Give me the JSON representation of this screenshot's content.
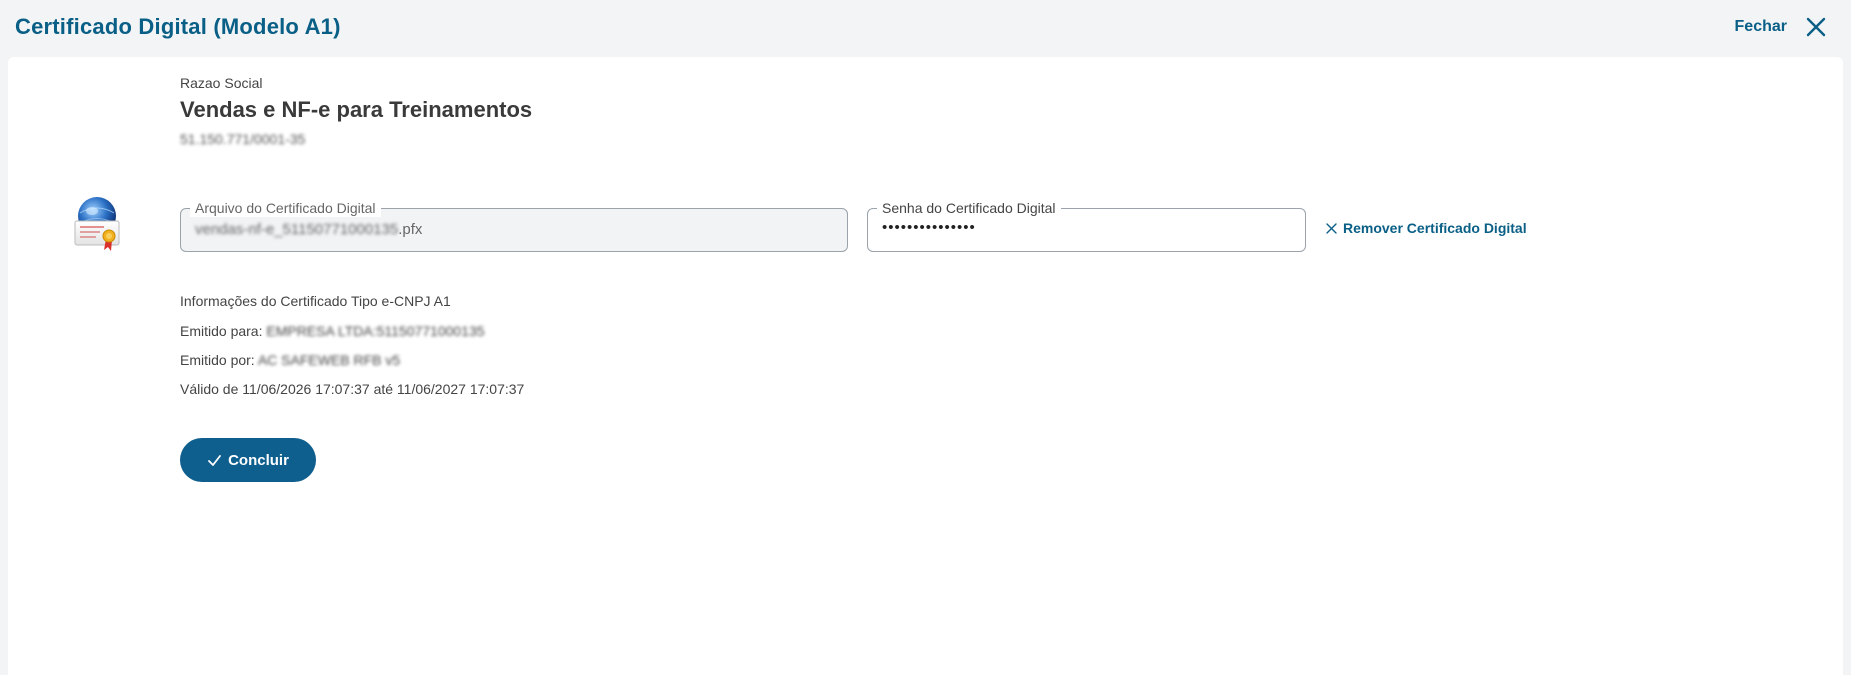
{
  "header": {
    "title": "Certificado Digital (Modelo A1)",
    "close_label": "Fechar"
  },
  "company": {
    "razao_label": "Razao Social",
    "name": "Vendas e NF-e para Treinamentos",
    "cnpj": "51.150.771/0001-35"
  },
  "fields": {
    "file": {
      "label": "Arquivo do Certificado Digital",
      "value_prefix": "vendas-nf-e_51150771000135",
      "value_ext": ".pfx"
    },
    "password": {
      "label": "Senha do Certificado Digital",
      "value": "•••••••••••••••"
    }
  },
  "remove_label": "Remover Certificado Digital",
  "info": {
    "title": "Informações do Certificado Tipo e-CNPJ A1",
    "emitido_para_label": "Emitido para:",
    "emitido_para_value": "EMPRESA LTDA:51150771000135",
    "emitido_por_label": "Emitido por:",
    "emitido_por_value": "AC SAFEWEB RFB v5",
    "validade": "Válido de 11/06/2026 17:07:37 até 11/06/2027 17:07:37"
  },
  "button": {
    "concluir_label": "Concluir"
  },
  "icons": {
    "close": "close-icon",
    "certificate": "certificate-icon",
    "remove": "close-icon",
    "check": "check-icon"
  },
  "colors": {
    "accent": "#0a5f86",
    "button": "#0e5f8e",
    "background": "#f3f4f6",
    "panel": "#ffffff"
  }
}
